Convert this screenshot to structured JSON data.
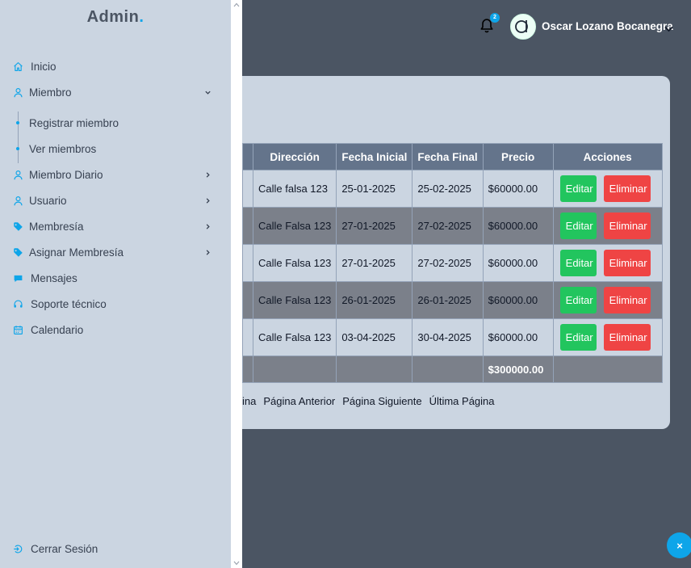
{
  "brand": {
    "name": "Admin",
    "dot": "."
  },
  "sidebar": {
    "items": [
      {
        "label": "Inicio",
        "icon": "home-icon"
      },
      {
        "label": "Miembro",
        "icon": "user-icon"
      },
      {
        "label": "Miembro Diario",
        "icon": "user-icon"
      },
      {
        "label": "Usuario",
        "icon": "user-icon"
      },
      {
        "label": "Membresía",
        "icon": "tag-icon"
      },
      {
        "label": "Asignar Membresía",
        "icon": "tag-icon"
      },
      {
        "label": "Mensajes",
        "icon": "chat-icon"
      },
      {
        "label": "Soporte técnico",
        "icon": "headset-icon"
      },
      {
        "label": "Calendario",
        "icon": "calendar-icon"
      }
    ],
    "subitems": [
      {
        "label": "Registrar miembro"
      },
      {
        "label": "Ver miembros"
      }
    ],
    "logout": "Cerrar Sesión"
  },
  "header": {
    "notifications_count": "2",
    "user_name": "Oscar Lozano Bocanegra"
  },
  "table": {
    "headers": [
      "Dirección",
      "Fecha Inicial",
      "Fecha Final",
      "Precio",
      "Acciones"
    ],
    "rows": [
      {
        "direccion": "Calle falsa 123",
        "inicio": "25-01-2025",
        "fin": "25-02-2025",
        "precio": "$60000.00"
      },
      {
        "direccion": "Calle Falsa 123",
        "inicio": "27-01-2025",
        "fin": "27-02-2025",
        "precio": "$60000.00"
      },
      {
        "direccion": "Calle Falsa 123",
        "inicio": "27-01-2025",
        "fin": "27-02-2025",
        "precio": "$60000.00"
      },
      {
        "direccion": "Calle Falsa 123",
        "inicio": "26-01-2025",
        "fin": "26-01-2025",
        "precio": "$60000.00"
      },
      {
        "direccion": "Calle Falsa 123",
        "inicio": "03-04-2025",
        "fin": "30-04-2025",
        "precio": "$60000.00"
      }
    ],
    "total": "$300000.00",
    "edit_label": "Editar",
    "delete_label": "Eliminar"
  },
  "pager": {
    "first_partial": "ina",
    "prev": "Página Anterior",
    "next": "Página Siguiente",
    "last": "Última Página"
  },
  "fab": {
    "symbol": "×"
  },
  "colors": {
    "accent": "#0ea5e9",
    "sidebar_bg": "#cbd5e1",
    "page_bg": "#4b5563",
    "edit": "#22c55e",
    "delete": "#ef4444"
  }
}
